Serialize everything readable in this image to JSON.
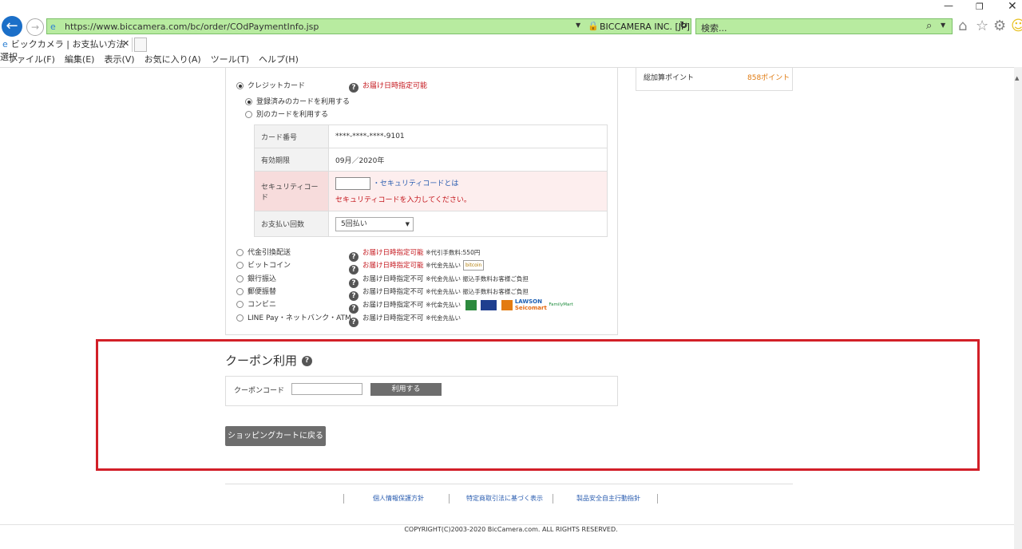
{
  "browser": {
    "url": "https://www.biccamera.com/bc/order/COdPaymentInfo.jsp",
    "site_identity": "BICCAMERA INC. [JP]",
    "search_placeholder": "検索...",
    "tab_title": "ビックカメラ | お支払い方法選択",
    "menu": [
      "ファイル(F)",
      "編集(E)",
      "表示(V)",
      "お気に入り(A)",
      "ツール(T)",
      "ヘルプ(H)"
    ]
  },
  "payment": {
    "credit_card_label": "クレジットカード",
    "credit_card_note": "お届け日時指定可能",
    "use_registered": "登録済みのカードを利用する",
    "use_other": "別のカードを利用する",
    "card_table": {
      "card_number_label": "カード番号",
      "card_number_value": "****-****-****-9101",
      "expiry_label": "有効期限",
      "expiry_value": "09月／2020年",
      "security_label": "セキュリティコード",
      "security_link": "セキュリティコードとは",
      "security_error": "セキュリティコードを入力してください。",
      "installments_label": "お支払い回数",
      "installments_value": "5回払い"
    },
    "methods": [
      {
        "label": "代金引換配送",
        "note": "お届け日時指定可能",
        "extra": "※代引手数料:550円"
      },
      {
        "label": "ビットコイン",
        "note": "お届け日時指定可能",
        "extra": "※代金先払い"
      },
      {
        "label": "銀行振込",
        "note": "お届け日時指定不可",
        "extra": "※代金先払い 振込手数料お客様ご負担"
      },
      {
        "label": "郵便振替",
        "note": "お届け日時指定不可",
        "extra": "※代金先払い 振込手数料お客様ご負担"
      },
      {
        "label": "コンビニ",
        "note": "お届け日時指定不可",
        "extra": "※代金先払い"
      },
      {
        "label": "LINE Pay・ネットバンク・ATM",
        "note": "お届け日時指定不可",
        "extra": "※代金先払い"
      }
    ],
    "logos": {
      "bitcoin": "bitcoin",
      "lawson": "LAWSON",
      "seicomart": "Seicomart",
      "familymart": "FamilyMart"
    }
  },
  "points": {
    "label": "総加算ポイント",
    "value": "858ポイント"
  },
  "coupon": {
    "title": "クーポン利用",
    "code_label": "クーポンコード",
    "apply_button": "利用する"
  },
  "back_to_cart": "ショッピングカートに戻る",
  "footer": {
    "links": [
      "個人情報保護方針",
      "特定商取引法に基づく表示",
      "製品安全自主行動指針"
    ],
    "copyright": "COPYRIGHT(C)2003-2020 BicCamera.com. ALL RIGHTS RESERVED."
  },
  "colors": {
    "accent_red": "#c4161c",
    "points_orange": "#e07a10",
    "highlight_border": "#d21f28",
    "address_bar": "#b8eba0"
  }
}
